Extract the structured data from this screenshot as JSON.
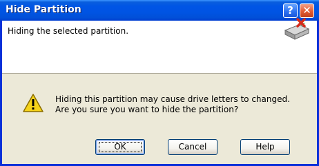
{
  "window": {
    "title": "Hide Partition",
    "help_button": "?",
    "close_button": "✕"
  },
  "header": {
    "text": "Hiding the selected partition.",
    "icon": "drive-delete-icon"
  },
  "message": {
    "icon": "warning-icon",
    "line1": "Hiding this partition may cause drive letters to changed.",
    "line2": "Are you sure you want to hide the partition?"
  },
  "buttons": {
    "ok": "OK",
    "cancel": "Cancel",
    "help": "Help"
  },
  "colors": {
    "titlebar": "#0054e3",
    "frame": "#0831d9",
    "dialog_bg": "#ece9d8",
    "close_red": "#e35a32",
    "warning_yellow": "#f5d31a"
  }
}
